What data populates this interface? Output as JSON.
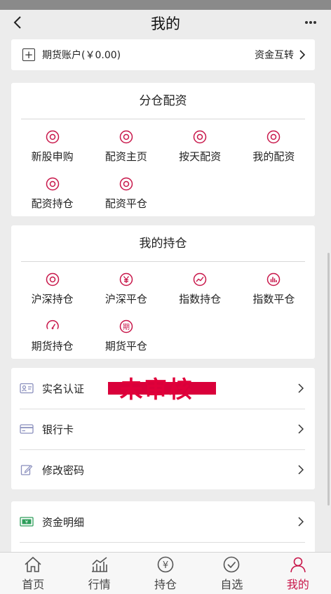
{
  "header": {
    "title": "我的"
  },
  "account": {
    "label": "期货账户(￥0.00)",
    "transfer_label": "资金互转"
  },
  "allocation": {
    "title": "分仓配资",
    "items": [
      {
        "label": "新股申购",
        "icon": "circle-target-icon"
      },
      {
        "label": "配资主页",
        "icon": "circle-target-icon"
      },
      {
        "label": "按天配资",
        "icon": "circle-target-icon"
      },
      {
        "label": "我的配资",
        "icon": "circle-target-icon"
      },
      {
        "label": "配资持仓",
        "icon": "circle-target-icon"
      },
      {
        "label": "配资平仓",
        "icon": "circle-target-icon"
      }
    ]
  },
  "holdings": {
    "title": "我的持仓",
    "items": [
      {
        "label": "沪深持仓",
        "icon": "circle-target-icon"
      },
      {
        "label": "沪深平仓",
        "icon": "yen-circle-icon"
      },
      {
        "label": "指数持仓",
        "icon": "trend-chart-icon"
      },
      {
        "label": "指数平仓",
        "icon": "bar-chart-icon"
      },
      {
        "label": "期货持仓",
        "icon": "gauge-icon"
      },
      {
        "label": "期货平仓",
        "icon": "period-char-icon",
        "glyph": "期"
      }
    ]
  },
  "settings": {
    "rows": [
      {
        "label": "实名认证",
        "icon": "id-card-icon",
        "stamp": "未审核"
      },
      {
        "label": "银行卡",
        "icon": "bank-card-icon"
      },
      {
        "label": "修改密码",
        "icon": "edit-icon"
      }
    ]
  },
  "funds": {
    "rows": [
      {
        "label": "资金明细",
        "icon": "money-icon"
      }
    ]
  },
  "tabbar": {
    "tabs": [
      {
        "label": "首页",
        "icon": "home-icon"
      },
      {
        "label": "行情",
        "icon": "market-chart-icon"
      },
      {
        "label": "持仓",
        "icon": "yen-coin-icon",
        "glyph": "¥"
      },
      {
        "label": "自选",
        "icon": "check-circle-icon"
      },
      {
        "label": "我的",
        "icon": "user-icon",
        "active": true
      }
    ]
  },
  "colors": {
    "accent": "#c8174a",
    "stamp": "#e0003a"
  }
}
